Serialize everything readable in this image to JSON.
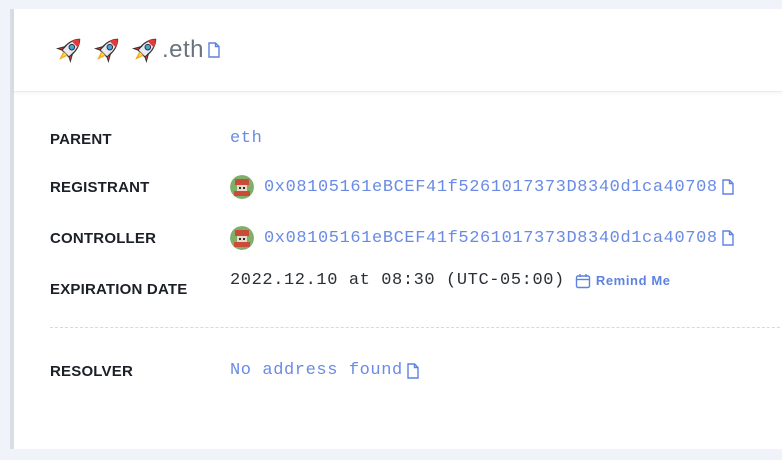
{
  "header": {
    "emoji_name": [
      "🚀",
      "🚀",
      "🚀"
    ],
    "suffix": ".eth",
    "copy_icon": "copy-icon"
  },
  "rows": {
    "parent": {
      "label": "PARENT",
      "value": "eth"
    },
    "registrant": {
      "label": "REGISTRANT",
      "value": "0x08105161eBCEF41f5261017373D8340d1ca40708"
    },
    "controller": {
      "label": "CONTROLLER",
      "value": "0x08105161eBCEF41f5261017373D8340d1ca40708"
    },
    "expiration": {
      "label": "EXPIRATION DATE",
      "value": "2022.12.10 at 08:30 (UTC-05:00)",
      "remind_label": "Remind Me"
    },
    "resolver": {
      "label": "RESOLVER",
      "value": "No address found"
    }
  },
  "colors": {
    "link": "#6a8be5",
    "label": "#1b1f27",
    "background": "#f0f4fa"
  }
}
